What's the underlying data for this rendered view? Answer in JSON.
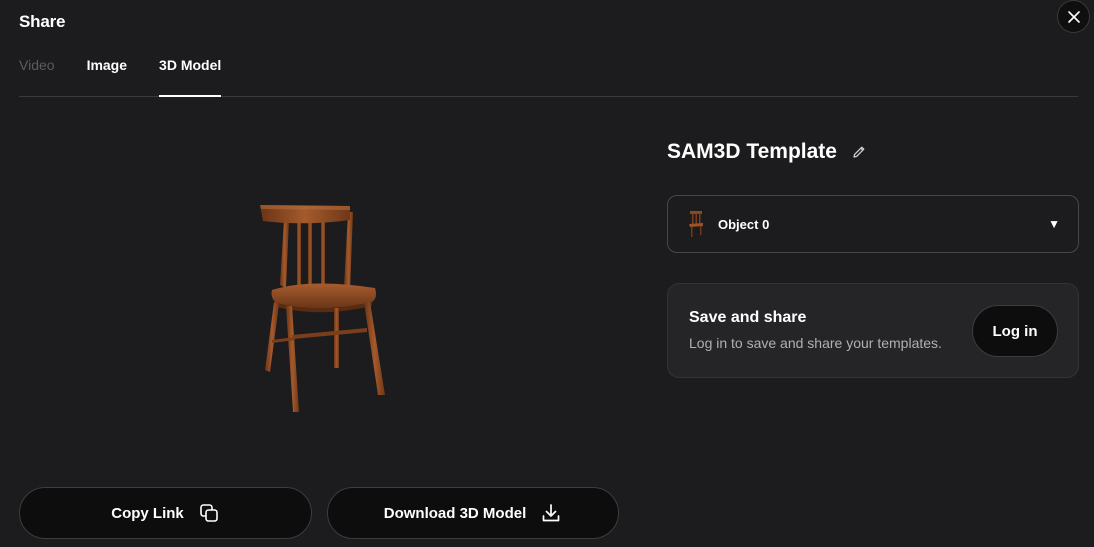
{
  "dialog": {
    "title": "Share",
    "close_icon": "close-icon"
  },
  "tabs": [
    {
      "label": "Video",
      "state": "disabled"
    },
    {
      "label": "Image",
      "state": "normal"
    },
    {
      "label": "3D Model",
      "state": "active"
    }
  ],
  "preview": {
    "image": "wooden-chair-3d-model"
  },
  "model": {
    "title": "SAM3D Template",
    "edit_icon": "pencil-icon"
  },
  "object_select": {
    "selected": "Object 0",
    "thumbnail": "chair-thumbnail",
    "caret_icon": "caret-down-icon"
  },
  "save_card": {
    "title": "Save and share",
    "description": "Log in to save and share your templates.",
    "login_label": "Log in"
  },
  "actions": {
    "copy_label": "Copy Link",
    "copy_icon": "copy-icon",
    "download_label": "Download 3D Model",
    "download_icon": "download-icon"
  },
  "colors": {
    "background": "#1c1c1e",
    "card": "#252528",
    "button": "#0d0d0e",
    "border": "#3d3d40",
    "muted_text": "#b0b0b4",
    "disabled_text": "#5c5c60",
    "chair_wood": "#8a4a22"
  }
}
